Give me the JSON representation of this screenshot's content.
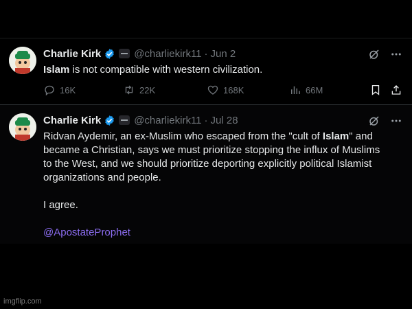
{
  "tweets": [
    {
      "name": "Charlie Kirk",
      "handle": "@charliekirk11",
      "separator": "·",
      "date": "Jun 2",
      "text_parts": {
        "bold": "Islam",
        "rest": " is not compatible with western civilization."
      },
      "stats": {
        "replies": "16K",
        "retweets": "22K",
        "likes": "168K",
        "views": "66M"
      }
    },
    {
      "name": "Charlie Kirk",
      "handle": "@charliekirk11",
      "separator": "·",
      "date": "Jul 28",
      "lines": {
        "l1a": "Ridvan Aydemir, an ex-Muslim who escaped from the \"cult of ",
        "l1b": "Islam",
        "l1c": "\" and",
        "l2": "became a Christian, says we must prioritize stopping the influx of Muslims",
        "l3": "to the West, and we should prioritize deporting explicitly political Islamist",
        "l4": "organizations and people.",
        "l5": "I agree.",
        "mention": "@ApostateProphet"
      }
    }
  ],
  "watermark": "imgflip.com",
  "colors": {
    "background": "#000000",
    "text": "#e7e9ea",
    "muted": "#71767b",
    "verified": "#1d9bf0",
    "mention": "#8b6cf0"
  },
  "icons": [
    "verified-badge-icon",
    "affiliate-badge-icon",
    "grok-icon",
    "more-icon",
    "reply-icon",
    "retweet-icon",
    "like-icon",
    "views-icon",
    "bookmark-icon",
    "share-icon"
  ]
}
